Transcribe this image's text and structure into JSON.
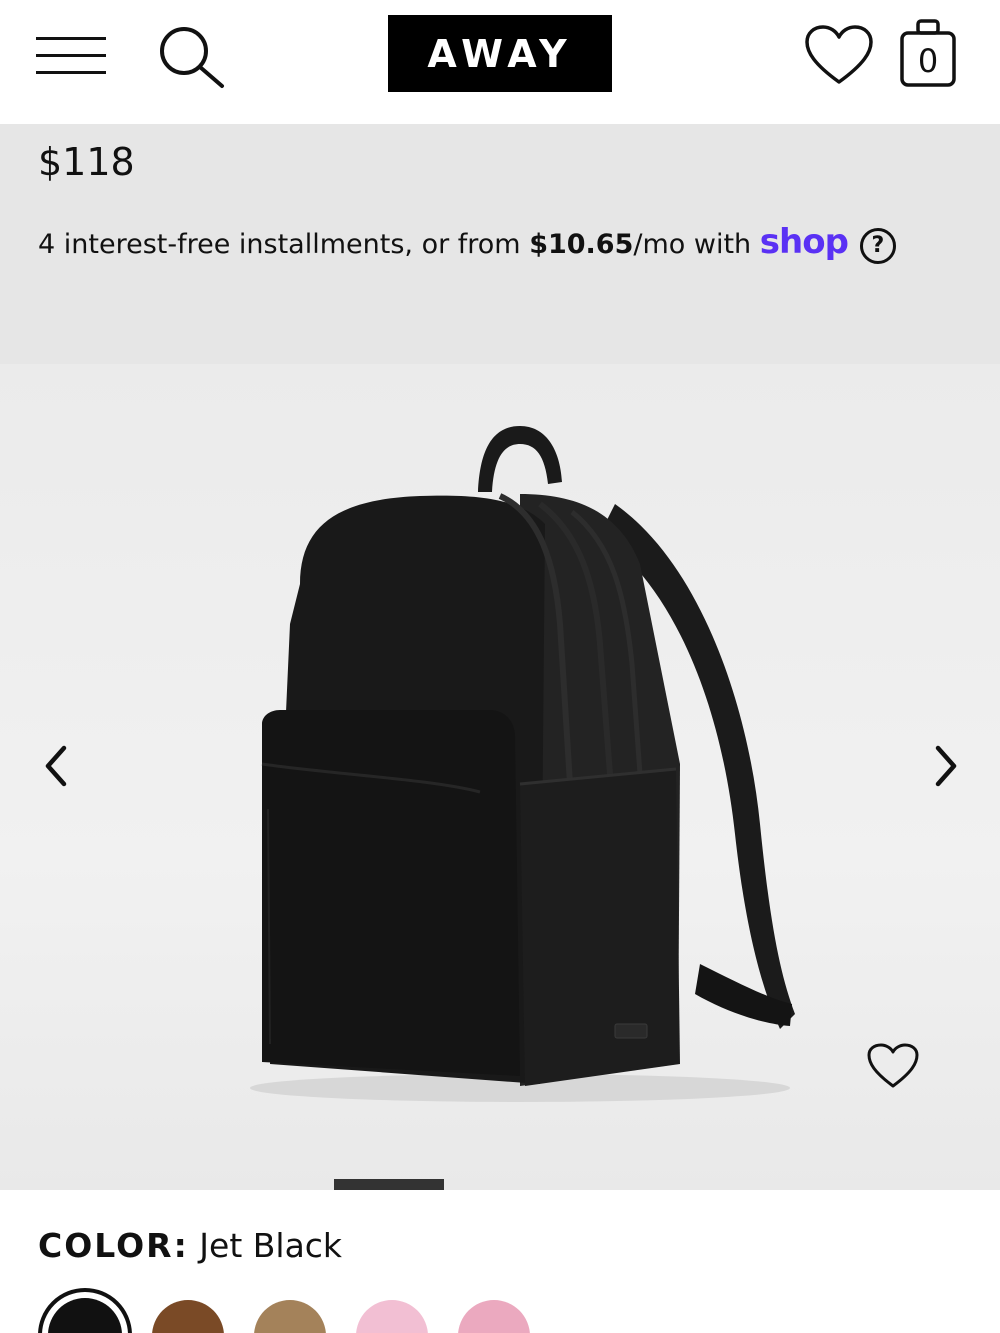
{
  "header": {
    "logo": "AWAY",
    "cart_count": "0"
  },
  "product": {
    "price": "$118",
    "installments_prefix": "4 interest-free installments, or from ",
    "installment_amount": "$10.65",
    "installments_suffix": "/mo with ",
    "shop_brand": "shop",
    "help_glyph": "?"
  },
  "color": {
    "label": "COLOR:",
    "value": "Jet Black",
    "swatches": [
      "#111111",
      "#7a4a26",
      "#a4825a",
      "#f2bfd3",
      "#eba9bf"
    ],
    "selected": 0
  },
  "colors": {
    "brand_shop": "#5a31f4",
    "price_band": "#e6e6e6"
  }
}
